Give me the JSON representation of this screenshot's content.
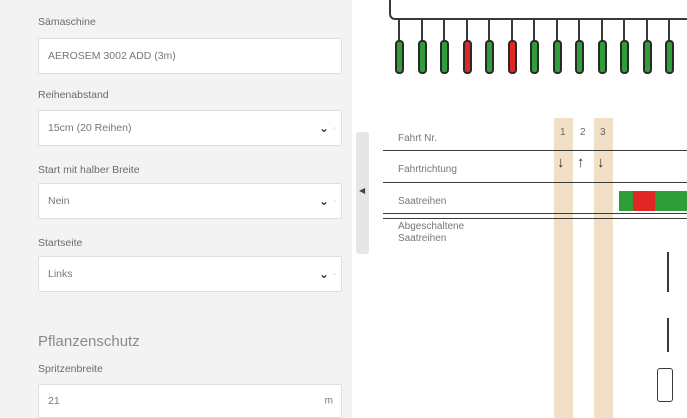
{
  "form": {
    "seed_machine": {
      "label": "Sämaschine",
      "value": "AEROSEM 3002 ADD (3m)"
    },
    "row_spacing": {
      "label": "Reihenabstand",
      "value": "15cm (20 Reihen)"
    },
    "half_width_start": {
      "label": "Start mit halber Breite",
      "value": "Nein"
    },
    "start_side": {
      "label": "Startseite",
      "value": "Links"
    },
    "plant_protection": {
      "heading": "Pflanzenschutz",
      "sprayer_width": {
        "label": "Spritzenbreite",
        "value": "21",
        "unit": "m"
      }
    }
  },
  "visualization": {
    "nozzle_colors": [
      "green",
      "green",
      "green",
      "red",
      "green",
      "red",
      "green",
      "green",
      "green",
      "green",
      "green",
      "green",
      "green",
      "green",
      "green"
    ],
    "rows": {
      "pass_no_label": "Fahrt Nr.",
      "direction_label": "Fahrtrichtung",
      "seed_rows_label": "Saatreihen",
      "disabled_rows_label": "Abgeschaltene Saatreihen"
    },
    "passes": [
      "1",
      "2",
      "3"
    ],
    "directions": [
      "↓",
      "↑",
      "↓"
    ],
    "colors": {
      "green": "#2f9e3a",
      "red": "#e12626",
      "lane": "#f1dfc6"
    }
  }
}
